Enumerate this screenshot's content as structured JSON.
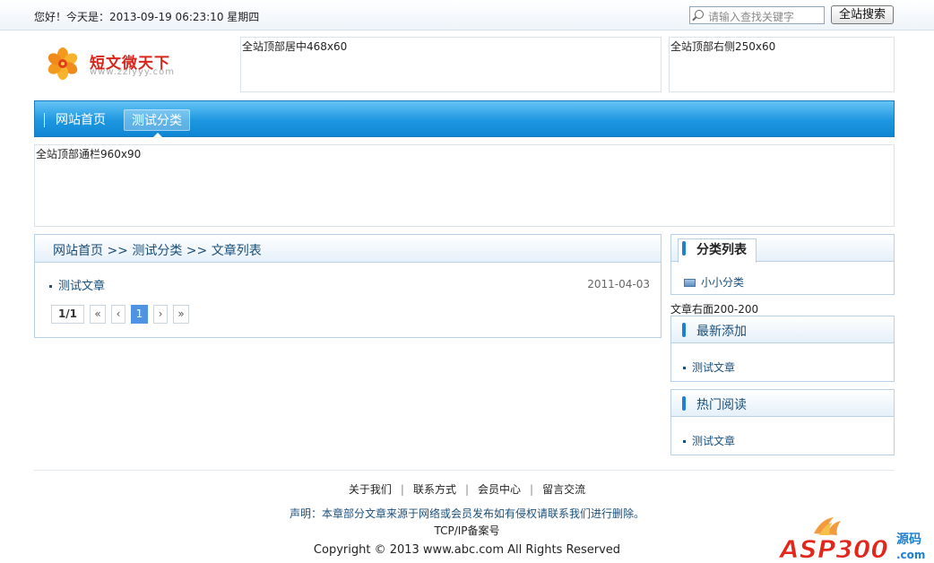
{
  "topbar": {
    "greeting": "您好！今天是：2013-09-19 06:23:10 星期四",
    "search_placeholder": "请输入查找关键字",
    "search_button": "全站搜索"
  },
  "logo": {
    "name": "短文微天下",
    "url": "www.zzlyyy.com"
  },
  "ads": {
    "top_center": "全站顶部居中468x60",
    "top_right": "全站顶部右侧250x60",
    "banner": "全站顶部通栏960x90",
    "article_right": "文章右面200-200"
  },
  "nav": {
    "items": [
      {
        "label": "网站首页"
      },
      {
        "label": "测试分类",
        "active": true
      }
    ]
  },
  "breadcrumb": "网站首页 >> 测试分类 >> 文章列表",
  "articles": [
    {
      "title": "测试文章",
      "date": "2011-04-03"
    }
  ],
  "pager": {
    "total": "1/1",
    "first": "«",
    "prev": "‹",
    "current": "1",
    "next": "›",
    "last": "»"
  },
  "sidebar": {
    "categories": {
      "title": "分类列表",
      "items": [
        {
          "label": "小小分类"
        }
      ]
    },
    "latest": {
      "title": "最新添加",
      "items": [
        {
          "label": "测试文章"
        }
      ]
    },
    "hot": {
      "title": "热门阅读",
      "items": [
        {
          "label": "测试文章"
        }
      ]
    }
  },
  "footer": {
    "links": [
      {
        "label": "关于我们"
      },
      {
        "label": "联系方式"
      },
      {
        "label": "会员中心"
      },
      {
        "label": "留言交流"
      }
    ],
    "separator": "|",
    "statement": "声明：本章部分文章来源于网络或会员发布如有侵权请联系我们进行删除。",
    "icp": "TCP/IP备案号",
    "copyright": "Copyright © 2013 www.abc.com All Rights Reserved"
  },
  "watermark": {
    "text": "ASP300",
    "suffix_cn": "源码",
    "suffix_en": ".com"
  },
  "colors": {
    "nav_blue": "#1e97e0",
    "link_blue": "#1a4f7a",
    "pager_active": "#4f94e4",
    "statement_blue": "#1a4f7a",
    "logo_red": "#d9261c"
  },
  "icons": {
    "search": "magnifier-icon",
    "category": "folder-icon",
    "logo": "flower-logo-icon"
  }
}
